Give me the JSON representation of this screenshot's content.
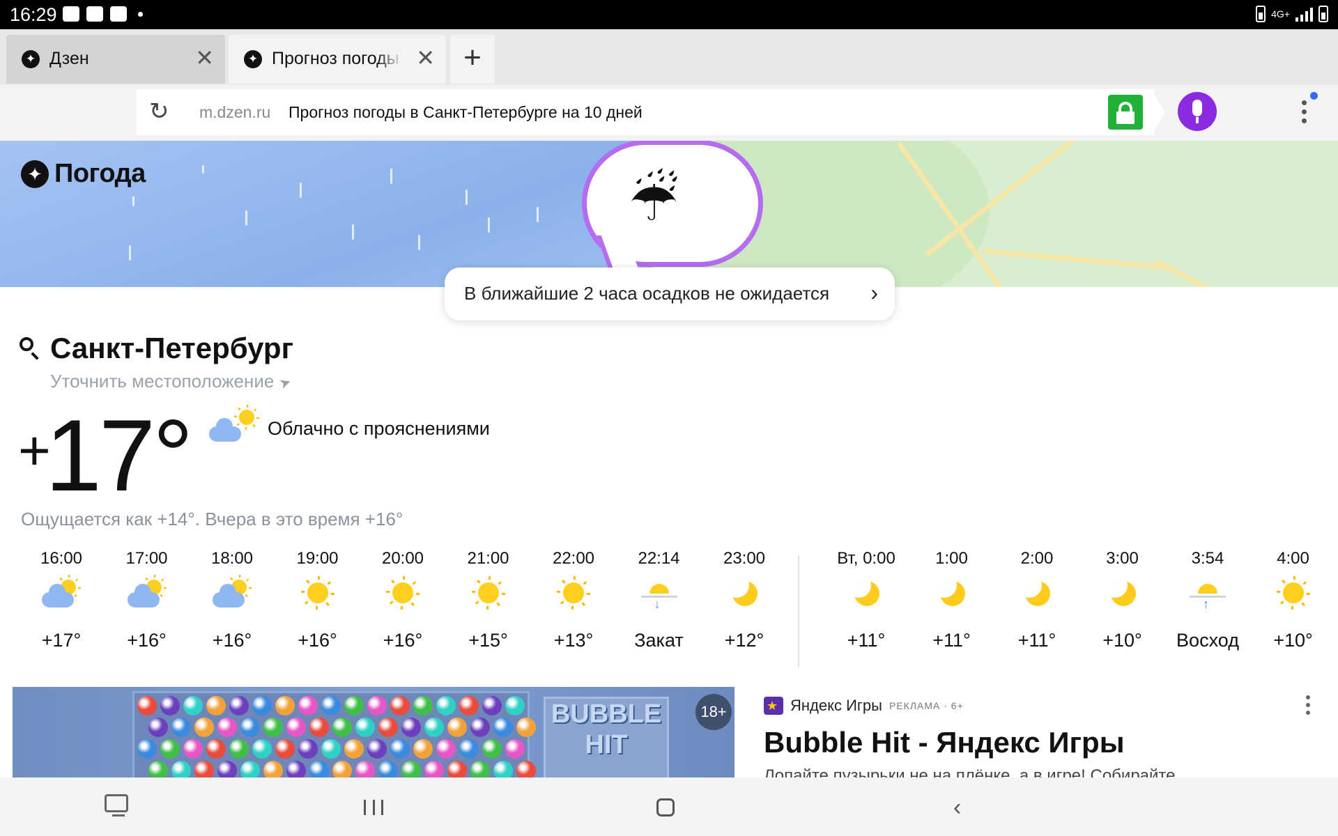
{
  "status_bar": {
    "time": "16:29",
    "network": "4G+"
  },
  "tabs": [
    {
      "title": "Дзен"
    },
    {
      "title": "Прогноз погоды"
    }
  ],
  "omnibox": {
    "domain": "m.dzen.ru",
    "page_title": "Прогноз погоды в Санкт-Петербурге на 10 дней"
  },
  "weather": {
    "brand": "Погода",
    "nowcast": "В ближайшие 2 часа осадков не ожидается",
    "city": "Санкт-Петербург",
    "refine_location": "Уточнить местоположение",
    "temperature": "17°",
    "temperature_sign": "+",
    "condition": "Облачно с прояснениями",
    "feels_like": "Ощущается как +14°. Вчера в это время +16°",
    "hourly": [
      {
        "time": "16:00",
        "icon": "partly-cloudy-icon",
        "value": "+17°"
      },
      {
        "time": "17:00",
        "icon": "partly-cloudy-icon",
        "value": "+16°"
      },
      {
        "time": "18:00",
        "icon": "partly-cloudy-icon",
        "value": "+16°"
      },
      {
        "time": "19:00",
        "icon": "sun-icon",
        "value": "+16°"
      },
      {
        "time": "20:00",
        "icon": "sun-icon",
        "value": "+16°"
      },
      {
        "time": "21:00",
        "icon": "sun-icon",
        "value": "+15°"
      },
      {
        "time": "22:00",
        "icon": "sun-icon",
        "value": "+13°"
      },
      {
        "time": "22:14",
        "icon": "sunset-icon",
        "value": "Закат"
      },
      {
        "time": "23:00",
        "icon": "moon-icon",
        "value": "+12°"
      },
      {
        "time": "Вт, 0:00",
        "icon": "moon-icon",
        "value": "+11°"
      },
      {
        "time": "1:00",
        "icon": "moon-icon",
        "value": "+11°"
      },
      {
        "time": "2:00",
        "icon": "moon-icon",
        "value": "+11°"
      },
      {
        "time": "3:00",
        "icon": "moon-icon",
        "value": "+10°"
      },
      {
        "time": "3:54",
        "icon": "sunrise-icon",
        "value": "Восход"
      },
      {
        "time": "4:00",
        "icon": "sun-icon",
        "value": "+10°"
      }
    ]
  },
  "ad": {
    "age_badge": "18+",
    "game_logo_line1": "BUBBLE",
    "game_logo_line2": "HIT",
    "source": "Яндекс Игры",
    "label": "РЕКЛАМА · 6+",
    "headline": "Bubble Hit - Яндекс Игры",
    "description": "Лопайте пузырьки не на плёнке, а в игре! Собирайте"
  },
  "colors": {
    "accent_purple": "#8a2be2",
    "lock_green": "#20b136",
    "status_bar": "#000000"
  }
}
